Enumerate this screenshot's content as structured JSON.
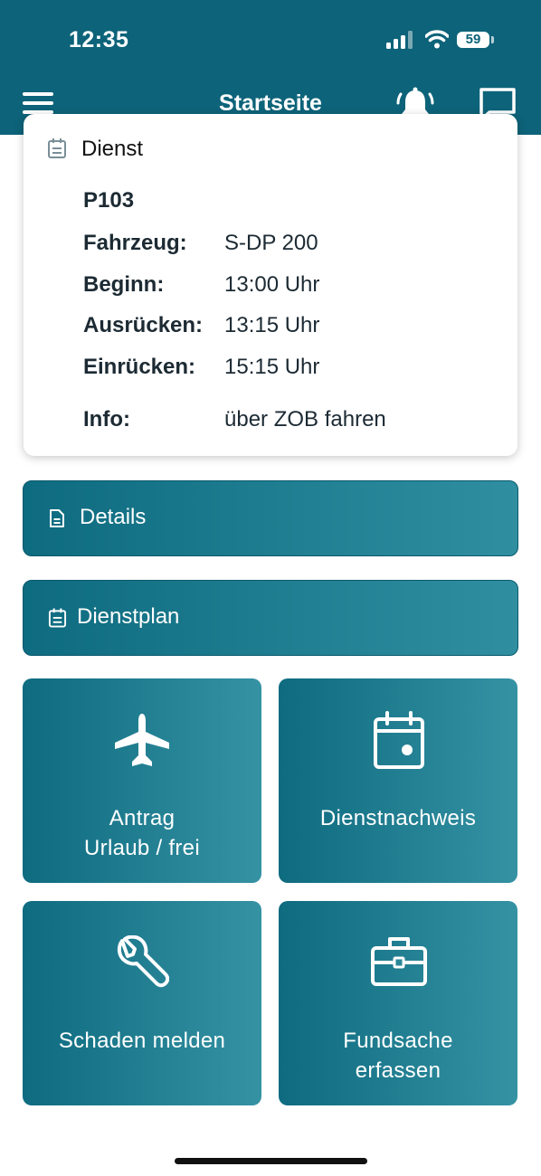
{
  "status_bar": {
    "time": "12:35",
    "battery": "59"
  },
  "header": {
    "title": "Startseite",
    "icons": [
      "menu-icon",
      "bell-icon",
      "chat-icon"
    ]
  },
  "duty_card": {
    "title": "Dienst",
    "code": "P103",
    "rows": [
      {
        "label": "Fahrzeug:",
        "value": "S-DP 200"
      },
      {
        "label": "Beginn:",
        "value": "13:00 Uhr"
      },
      {
        "label": "Ausrücken:",
        "value": "13:15 Uhr"
      },
      {
        "label": "Einrücken:",
        "value": "15:15 Uhr"
      },
      {
        "label": "Info:",
        "value": "über ZOB fahren"
      }
    ]
  },
  "buttons": {
    "details": "Details",
    "dienstplan": "Dienstplan"
  },
  "tiles": {
    "antrag_line1": "Antrag",
    "antrag_line2": "Urlaub / frei",
    "dienstnachweis": "Dienstnachweis",
    "schaden": "Schaden melden",
    "fundsache_line1": "Fundsache",
    "fundsache_line2": "erfassen"
  },
  "colors": {
    "primary": "#0d6379",
    "gradient_end": "#3592a3"
  }
}
